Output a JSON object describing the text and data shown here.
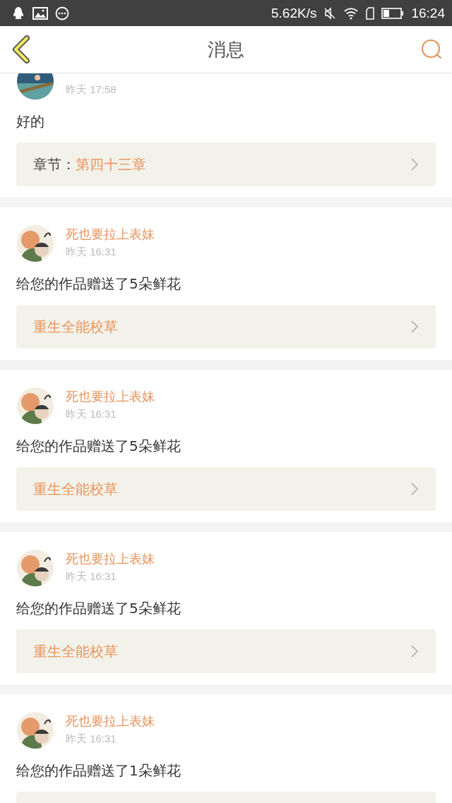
{
  "status_bar": {
    "speed": "5.62K/s",
    "time": "16:24"
  },
  "header": {
    "title": "消息"
  },
  "messages": [
    {
      "kind": "chapter",
      "time": "昨天 17:58",
      "text": "好的",
      "link_label": "章节：",
      "link_title": "第四十三章"
    },
    {
      "kind": "work",
      "name": "死也要拉上表妹",
      "time": "昨天 16:31",
      "text": "给您的作品赠送了5朵鲜花",
      "link_title": "重生全能校草"
    },
    {
      "kind": "work",
      "name": "死也要拉上表妹",
      "time": "昨天 16:31",
      "text": "给您的作品赠送了5朵鲜花",
      "link_title": "重生全能校草"
    },
    {
      "kind": "work",
      "name": "死也要拉上表妹",
      "time": "昨天 16:31",
      "text": "给您的作品赠送了5朵鲜花",
      "link_title": "重生全能校草"
    },
    {
      "kind": "work",
      "name": "死也要拉上表妹",
      "time": "昨天 16:31",
      "text": "给您的作品赠送了1朵鲜花"
    }
  ]
}
